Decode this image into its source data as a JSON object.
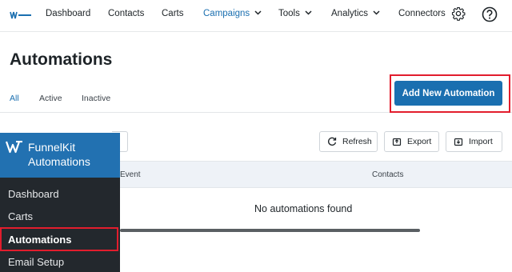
{
  "nav": {
    "logo_text": "FunnelKit",
    "items": [
      {
        "label": "Dashboard"
      },
      {
        "label": "Contacts"
      },
      {
        "label": "Carts"
      },
      {
        "label": "Campaigns"
      },
      {
        "label": "Tools"
      },
      {
        "label": "Analytics"
      },
      {
        "label": "Connectors"
      }
    ],
    "active_item": "Campaigns",
    "icons": [
      "gear-icon",
      "help-icon"
    ]
  },
  "page": {
    "title": "Automations",
    "tabs": [
      {
        "label": "All"
      },
      {
        "label": "Active"
      },
      {
        "label": "Inactive"
      }
    ],
    "active_tab": "All",
    "add_button": "Add New Automation"
  },
  "toolbar": {
    "refresh": "Refresh",
    "export": "Export",
    "import": "Import"
  },
  "table": {
    "columns": [
      "Event",
      "Contacts"
    ],
    "empty_message": "No automations found"
  },
  "sidebar": {
    "brand_line1": "FunnelKit",
    "brand_line2": "Automations",
    "items": [
      {
        "label": "Dashboard"
      },
      {
        "label": "Carts"
      },
      {
        "label": "Automations"
      },
      {
        "label": "Email Setup"
      }
    ],
    "current_item": "Automations"
  },
  "colors": {
    "accent": "#1a6fb0",
    "highlight": "#e21d2d",
    "sidebar_bg": "#23282d",
    "brand_bg": "#2271b1"
  }
}
